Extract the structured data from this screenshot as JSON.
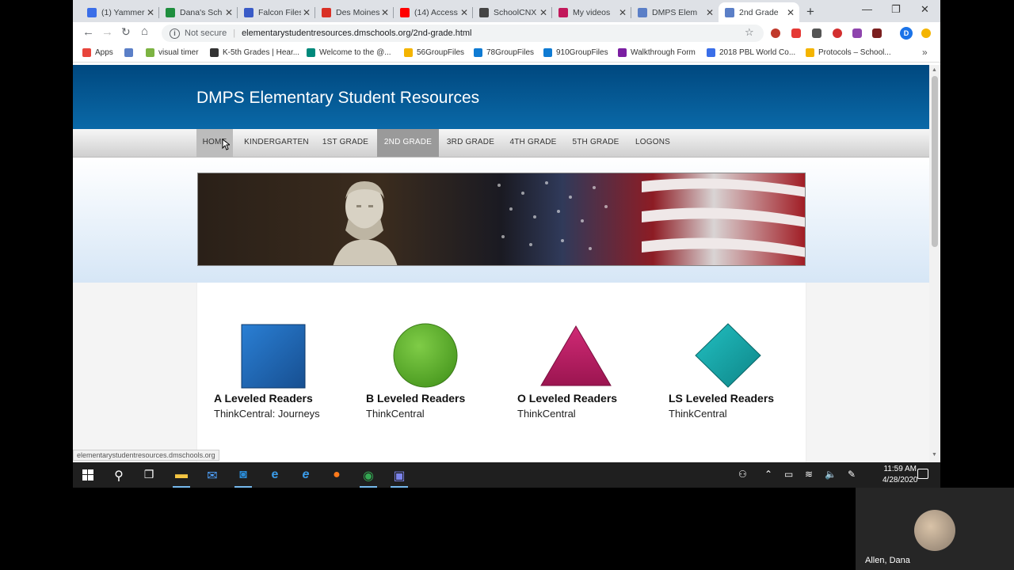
{
  "browser": {
    "tabs": [
      {
        "title": "(1) Yammer",
        "color": "#3a6ee8"
      },
      {
        "title": "Dana's Sch",
        "color": "#1e8e3e"
      },
      {
        "title": "Falcon Files",
        "color": "#3a5bc7"
      },
      {
        "title": "Des Moines",
        "color": "#d93025"
      },
      {
        "title": "(14) Access",
        "color": "#ff0000"
      },
      {
        "title": "SchoolCNX",
        "color": "#444444"
      },
      {
        "title": "My videos",
        "color": "#c2185b"
      },
      {
        "title": "DMPS Elem",
        "color": "#5b7fc7"
      },
      {
        "title": "2nd Grade",
        "color": "#5b7fc7"
      }
    ],
    "new_tab": "+",
    "window_controls": {
      "minimize": "—",
      "restore": "❐",
      "close": "✕"
    },
    "security_label": "Not secure",
    "url": "elementarystudentresources.dmschools.org/2nd-grade.html",
    "bookmarks": [
      {
        "label": "Apps",
        "color": "#e8453c"
      },
      {
        "label": "",
        "color": "#5b7fc7"
      },
      {
        "label": "visual timer",
        "color": "#7cb342"
      },
      {
        "label": "K-5th Grades | Hear...",
        "color": "#333333"
      },
      {
        "label": "Welcome to the @...",
        "color": "#00897b"
      },
      {
        "label": "56GroupFiles",
        "color": "#f4b400"
      },
      {
        "label": "78GroupFiles",
        "color": "#0f7bd3"
      },
      {
        "label": "910GroupFiles",
        "color": "#0f7bd3"
      },
      {
        "label": "Walkthrough Form",
        "color": "#7b1fa2"
      },
      {
        "label": "2018 PBL World Co...",
        "color": "#3a6ee8"
      },
      {
        "label": "Protocols – School...",
        "color": "#f4b400"
      }
    ],
    "profile_initial": "D",
    "status_url": "elementarystudentresources.dmschools.org"
  },
  "site": {
    "title": "DMPS Elementary Student Resources",
    "nav": [
      {
        "label": "HOME"
      },
      {
        "label": "KINDERGARTEN"
      },
      {
        "label": "1ST GRADE"
      },
      {
        "label": "2ND GRADE"
      },
      {
        "label": "3RD GRADE"
      },
      {
        "label": "4TH GRADE"
      },
      {
        "label": "5TH GRADE"
      },
      {
        "label": "LOGONS"
      }
    ],
    "cards": [
      {
        "title": "A Leveled Readers",
        "subtitle": "ThinkCentral: Journeys",
        "shape": "square",
        "color": "#1f64b4"
      },
      {
        "title": "B Leveled Readers",
        "subtitle": "ThinkCentral",
        "shape": "circle",
        "color": "#62b033"
      },
      {
        "title": "O Leveled Readers",
        "subtitle": "ThinkCentral",
        "shape": "triangle",
        "color": "#b3195f"
      },
      {
        "title": "LS Leveled Readers",
        "subtitle": "ThinkCentral",
        "shape": "diamond",
        "color": "#14a3a6"
      }
    ]
  },
  "taskbar": {
    "time": "11:59 AM",
    "date": "4/28/2020"
  },
  "webcam": {
    "name": "Allen, Dana"
  }
}
